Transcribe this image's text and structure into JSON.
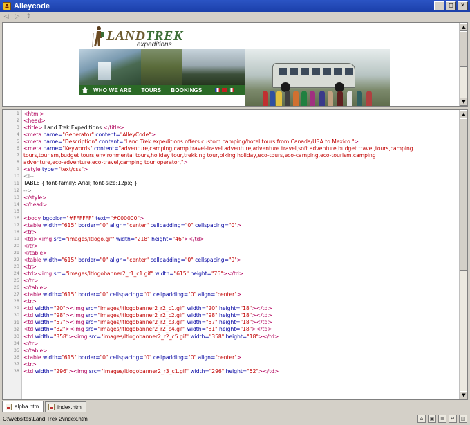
{
  "window": {
    "title": "Alleycode"
  },
  "toolbar": {
    "icons": [
      "back-icon",
      "forward-icon",
      "refresh-icon"
    ]
  },
  "preview": {
    "logo_main": "LAND",
    "logo_trek": "TREK",
    "logo_sub": "expeditions",
    "nav": [
      "WHO WE ARE",
      "TOURS",
      "BOOKINGS"
    ]
  },
  "code_lines": [
    [
      [
        "tag",
        "<html>"
      ]
    ],
    [
      [
        "tag",
        "<head>"
      ]
    ],
    [
      [
        "tag",
        "<title>"
      ],
      [
        "txt",
        " Land Trek Expeditions "
      ],
      [
        "tag",
        "</title>"
      ]
    ],
    [
      [
        "tag",
        "<meta "
      ],
      [
        "attr",
        "name="
      ],
      [
        "val",
        "\"Generator\""
      ],
      [
        "attr",
        " content="
      ],
      [
        "val",
        "\"AlleyCode\""
      ],
      [
        "tag",
        ">"
      ]
    ],
    [
      [
        "tag",
        "<meta "
      ],
      [
        "attr",
        "name="
      ],
      [
        "val",
        "\"Description\""
      ],
      [
        "attr",
        " content="
      ],
      [
        "val",
        "\"Land Trek expeditions offers custom camping/hotel tours from Canada/USA to Mexico.\""
      ],
      [
        "tag",
        ">"
      ]
    ],
    [
      [
        "tag",
        "<meta "
      ],
      [
        "attr",
        "name="
      ],
      [
        "val",
        "\"Keywords\""
      ],
      [
        "attr",
        " content="
      ],
      [
        "val",
        "\"adventure,camping,camp,travel-travel adventure,adventure travel,soft adventure,budget travel,tours,camping"
      ]
    ],
    [
      [
        "val",
        "tours,tourism,budget tours,environmental tours,holiday tour,trekking tour,biking holiday,eco-tours,eco-camping,eco-tourism,camping"
      ]
    ],
    [
      [
        "val",
        "adventure,eco-adventure,eco-travel,camping tour operator,\""
      ],
      [
        "tag",
        ">"
      ]
    ],
    [
      [
        "tag",
        "<style "
      ],
      [
        "attr",
        "type="
      ],
      [
        "val",
        "\"text/css\""
      ],
      [
        "tag",
        ">"
      ]
    ],
    [
      [
        "cmt",
        "<!--"
      ]
    ],
    [
      [
        "txt",
        "   TABLE { font-family: Arial; font-size:12px; }"
      ]
    ],
    [
      [
        "cmt",
        "-->"
      ]
    ],
    [
      [
        "tag",
        "</style>"
      ]
    ],
    [
      [
        "tag",
        "</head>"
      ]
    ],
    [
      [
        "txt",
        ""
      ]
    ],
    [
      [
        "tag",
        "<body "
      ],
      [
        "attr",
        "bgcolor="
      ],
      [
        "val",
        "\"#FFFFFF\""
      ],
      [
        "attr",
        " text="
      ],
      [
        "val",
        "\"#000000\""
      ],
      [
        "tag",
        ">"
      ]
    ],
    [
      [
        "tag",
        "<table "
      ],
      [
        "attr",
        "width="
      ],
      [
        "val",
        "\"615\""
      ],
      [
        "attr",
        " border="
      ],
      [
        "val",
        "\"0\""
      ],
      [
        "attr",
        " align="
      ],
      [
        "val",
        "\"center\""
      ],
      [
        "attr",
        " cellpadding="
      ],
      [
        "val",
        "\"0\""
      ],
      [
        "attr",
        " cellspacing="
      ],
      [
        "val",
        "\"0\""
      ],
      [
        "tag",
        ">"
      ]
    ],
    [
      [
        "tag",
        "  <tr>"
      ]
    ],
    [
      [
        "tag",
        "  <td>"
      ],
      [
        "tag",
        "<img "
      ],
      [
        "attr",
        "src="
      ],
      [
        "val",
        "\"images/ltlogo.gif\""
      ],
      [
        "attr",
        " width="
      ],
      [
        "val",
        "\"218\""
      ],
      [
        "attr",
        " height="
      ],
      [
        "val",
        "\"46\""
      ],
      [
        "tag",
        "></td>"
      ]
    ],
    [
      [
        "tag",
        "  </tr>"
      ]
    ],
    [
      [
        "tag",
        "</table>"
      ]
    ],
    [
      [
        "tag",
        "<table "
      ],
      [
        "attr",
        "width="
      ],
      [
        "val",
        "\"615\""
      ],
      [
        "attr",
        " border="
      ],
      [
        "val",
        "\"0\""
      ],
      [
        "attr",
        " align="
      ],
      [
        "val",
        "\"center\""
      ],
      [
        "attr",
        " cellpadding="
      ],
      [
        "val",
        "\"0\""
      ],
      [
        "attr",
        " cellspacing="
      ],
      [
        "val",
        "\"0\""
      ],
      [
        "tag",
        ">"
      ]
    ],
    [
      [
        "tag",
        "  <tr>"
      ]
    ],
    [
      [
        "tag",
        "  <td>"
      ],
      [
        "tag",
        "<img "
      ],
      [
        "attr",
        "src="
      ],
      [
        "val",
        "\"images/ltlogobanner2_r1_c1.gif\""
      ],
      [
        "attr",
        " width="
      ],
      [
        "val",
        "\"615\""
      ],
      [
        "attr",
        " height="
      ],
      [
        "val",
        "\"76\""
      ],
      [
        "tag",
        "></td>"
      ]
    ],
    [
      [
        "tag",
        "  </tr>"
      ]
    ],
    [
      [
        "tag",
        "</table>"
      ]
    ],
    [
      [
        "tag",
        "<table "
      ],
      [
        "attr",
        "width="
      ],
      [
        "val",
        "\"615\""
      ],
      [
        "attr",
        " border="
      ],
      [
        "val",
        "\"0\""
      ],
      [
        "attr",
        " cellspacing="
      ],
      [
        "val",
        "\"0\""
      ],
      [
        "attr",
        " cellpadding="
      ],
      [
        "val",
        "\"0\""
      ],
      [
        "attr",
        " align="
      ],
      [
        "val",
        "\"center\""
      ],
      [
        "tag",
        ">"
      ]
    ],
    [
      [
        "tag",
        "  <tr>"
      ]
    ],
    [
      [
        "tag",
        "  <td "
      ],
      [
        "attr",
        "width="
      ],
      [
        "val",
        "\"20\""
      ],
      [
        "tag",
        ">"
      ],
      [
        "tag",
        "<img "
      ],
      [
        "attr",
        "src="
      ],
      [
        "val",
        "\"images/ltlogobanner2_r2_c1.gif\""
      ],
      [
        "attr",
        " width="
      ],
      [
        "val",
        "\"20\""
      ],
      [
        "attr",
        " height="
      ],
      [
        "val",
        "\"18\""
      ],
      [
        "tag",
        "></td>"
      ]
    ],
    [
      [
        "tag",
        "  <td "
      ],
      [
        "attr",
        "width="
      ],
      [
        "val",
        "\"98\""
      ],
      [
        "tag",
        ">"
      ],
      [
        "tag",
        "<img "
      ],
      [
        "attr",
        "src="
      ],
      [
        "val",
        "\"images/ltlogobanner2_r2_c2.gif\""
      ],
      [
        "attr",
        " width="
      ],
      [
        "val",
        "\"98\""
      ],
      [
        "attr",
        " height="
      ],
      [
        "val",
        "\"18\""
      ],
      [
        "tag",
        "></td>"
      ]
    ],
    [
      [
        "tag",
        "  <td "
      ],
      [
        "attr",
        "width="
      ],
      [
        "val",
        "\"57\""
      ],
      [
        "tag",
        ">"
      ],
      [
        "tag",
        "<img "
      ],
      [
        "attr",
        "src="
      ],
      [
        "val",
        "\"images/ltlogobanner2_r2_c3.gif\""
      ],
      [
        "attr",
        " width="
      ],
      [
        "val",
        "\"57\""
      ],
      [
        "attr",
        " height="
      ],
      [
        "val",
        "\"18\""
      ],
      [
        "tag",
        "></td>"
      ]
    ],
    [
      [
        "tag",
        "  <td "
      ],
      [
        "attr",
        "width="
      ],
      [
        "val",
        "\"82\""
      ],
      [
        "tag",
        ">"
      ],
      [
        "tag",
        "<img "
      ],
      [
        "attr",
        "src="
      ],
      [
        "val",
        "\"images/ltlogobanner2_r2_c4.gif\""
      ],
      [
        "attr",
        " width="
      ],
      [
        "val",
        "\"81\""
      ],
      [
        "attr",
        " height="
      ],
      [
        "val",
        "\"18\""
      ],
      [
        "tag",
        "></td>"
      ]
    ],
    [
      [
        "tag",
        "  <td "
      ],
      [
        "attr",
        "width="
      ],
      [
        "val",
        "\"358\""
      ],
      [
        "tag",
        ">"
      ],
      [
        "tag",
        "<img "
      ],
      [
        "attr",
        "src="
      ],
      [
        "val",
        "\"images/ltlogobanner2_r2_c5.gif\""
      ],
      [
        "attr",
        " width="
      ],
      [
        "val",
        "\"358\""
      ],
      [
        "attr",
        " height="
      ],
      [
        "val",
        "\"18\""
      ],
      [
        "tag",
        "></td>"
      ]
    ],
    [
      [
        "tag",
        "  </tr>"
      ]
    ],
    [
      [
        "tag",
        "</table>"
      ]
    ],
    [
      [
        "tag",
        "<table "
      ],
      [
        "attr",
        "width="
      ],
      [
        "val",
        "\"615\""
      ],
      [
        "attr",
        " border="
      ],
      [
        "val",
        "\"0\""
      ],
      [
        "attr",
        " cellspacing="
      ],
      [
        "val",
        "\"0\""
      ],
      [
        "attr",
        " cellpadding="
      ],
      [
        "val",
        "\"0\""
      ],
      [
        "attr",
        " align="
      ],
      [
        "val",
        "\"center\""
      ],
      [
        "tag",
        ">"
      ]
    ],
    [
      [
        "tag",
        "  <tr>"
      ]
    ],
    [
      [
        "tag",
        "  <td "
      ],
      [
        "attr",
        "width="
      ],
      [
        "val",
        "\"296\""
      ],
      [
        "tag",
        ">"
      ],
      [
        "tag",
        "<img "
      ],
      [
        "attr",
        "src="
      ],
      [
        "val",
        "\"images/ltlogobanner2_r3_c1.gif\""
      ],
      [
        "attr",
        " width="
      ],
      [
        "val",
        "\"296\""
      ],
      [
        "attr",
        " height="
      ],
      [
        "val",
        "\"52\""
      ],
      [
        "tag",
        "></td>"
      ]
    ]
  ],
  "tabs": [
    {
      "label": "alpha.htm",
      "active": true
    },
    {
      "label": "index.htm",
      "active": false
    }
  ],
  "status": {
    "path": "C:\\websites\\Land Trek 2\\index.htm"
  }
}
